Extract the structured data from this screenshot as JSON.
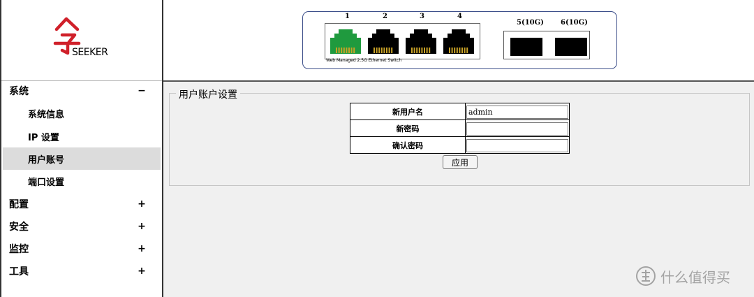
{
  "brand": {
    "logo_text": "SEEKER"
  },
  "sidebar": {
    "items": [
      {
        "label": "系统",
        "toggle": "−",
        "type": "top"
      },
      {
        "label": "系统信息",
        "type": "sub"
      },
      {
        "label": "IP 设置",
        "type": "sub"
      },
      {
        "label": "用户账号",
        "type": "sub",
        "active": true
      },
      {
        "label": "端口设置",
        "type": "sub"
      },
      {
        "label": "配置",
        "toggle": "+",
        "type": "top"
      },
      {
        "label": "安全",
        "toggle": "+",
        "type": "top"
      },
      {
        "label": "监控",
        "toggle": "+",
        "type": "top"
      },
      {
        "label": "工具",
        "toggle": "+",
        "type": "top"
      }
    ]
  },
  "switch": {
    "ports": [
      {
        "num": "1",
        "status_color": "#1f9a3e"
      },
      {
        "num": "2",
        "status_color": "#000000"
      },
      {
        "num": "3",
        "status_color": "#000000"
      },
      {
        "num": "4",
        "status_color": "#000000"
      }
    ],
    "sfp": [
      {
        "label": "5(10G)"
      },
      {
        "label": "6(10G)"
      }
    ],
    "caption": "Web Managed 2.5G Ethernet Switch",
    "pin_color": "#c9a227"
  },
  "account": {
    "legend": "用户账户设置",
    "rows": [
      {
        "label": "新用户名",
        "value": "admin"
      },
      {
        "label": "新密码",
        "value": ""
      },
      {
        "label": "确认密码",
        "value": ""
      }
    ],
    "apply_label": "应用"
  },
  "watermark": {
    "text": "什么值得买",
    "icon": "zhi-logo-icon"
  },
  "colors": {
    "accent_red": "#d0202a",
    "panel_border": "#3d4f8a",
    "active_item": "#dcdcdc"
  }
}
